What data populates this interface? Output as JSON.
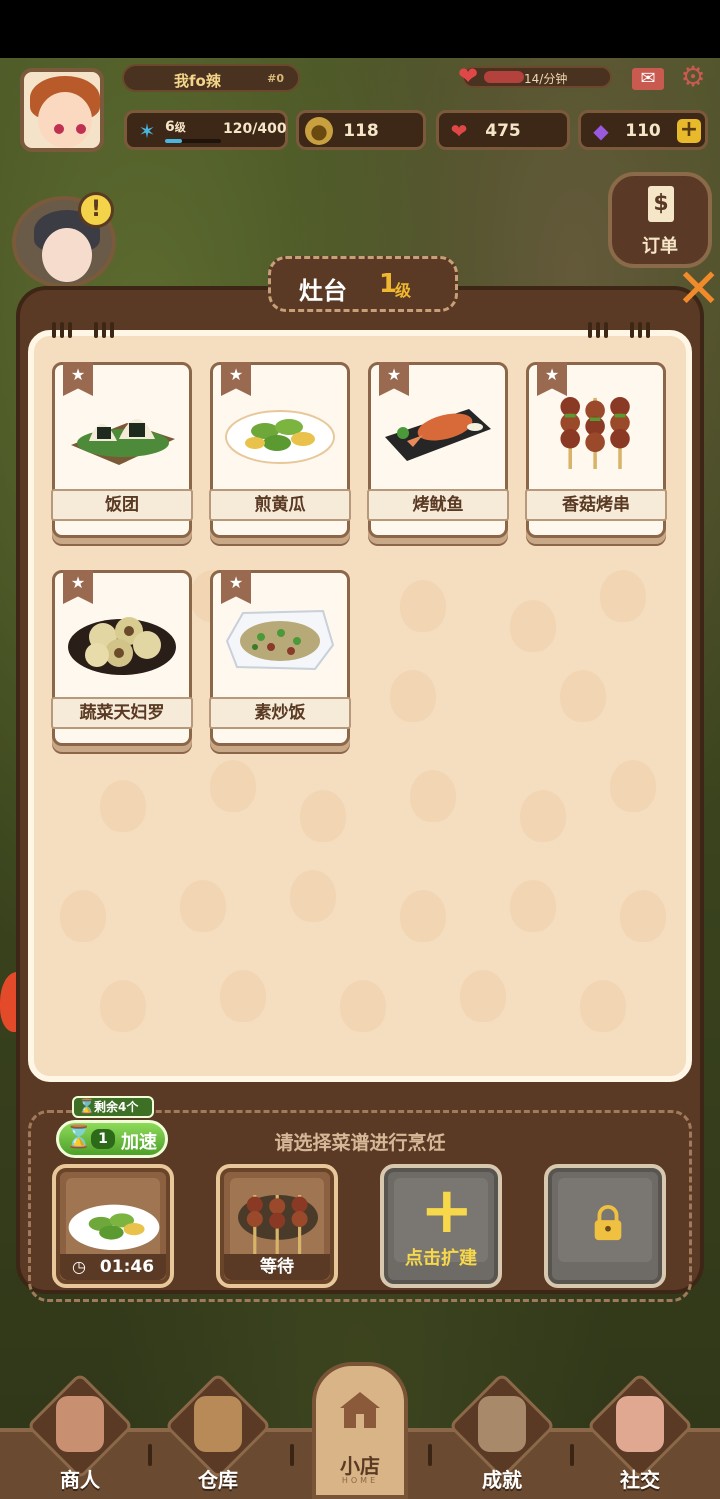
{
  "header": {
    "player_name": "我fo辣",
    "player_id": "#0",
    "energy_rate": "14/分钟",
    "level_value": "6",
    "level_suffix": "级",
    "exp_text": "120/400",
    "coins": "118",
    "hearts": "475",
    "gems": "110"
  },
  "side": {
    "order_label": "订单"
  },
  "panel": {
    "title": "灶台",
    "level_number": "1",
    "level_suffix": "级"
  },
  "recipes": [
    {
      "name": "饭团"
    },
    {
      "name": "煎黄瓜"
    },
    {
      "name": "烤鱿鱼"
    },
    {
      "name": "香菇烤串"
    },
    {
      "name": "蔬菜天妇罗"
    },
    {
      "name": "素炒饭"
    }
  ],
  "cooking": {
    "hint": "请选择菜谱进行烹饪",
    "remaining_tag": "剩余4个",
    "speed_count": "1",
    "speed_label": "加速",
    "slot1_timer": "01:46",
    "slot2_status": "等待",
    "expand_label": "点击扩建"
  },
  "nav": {
    "merchant": "商人",
    "warehouse": "仓库",
    "shop": "小店",
    "shop_sub": "HOME",
    "achievement": "成就",
    "social": "社交"
  },
  "colors": {
    "panel_bg": "#5a3a24",
    "paper": "#f5dec0",
    "accent_gold": "#f0b830",
    "green_button": "#4ea02a"
  }
}
